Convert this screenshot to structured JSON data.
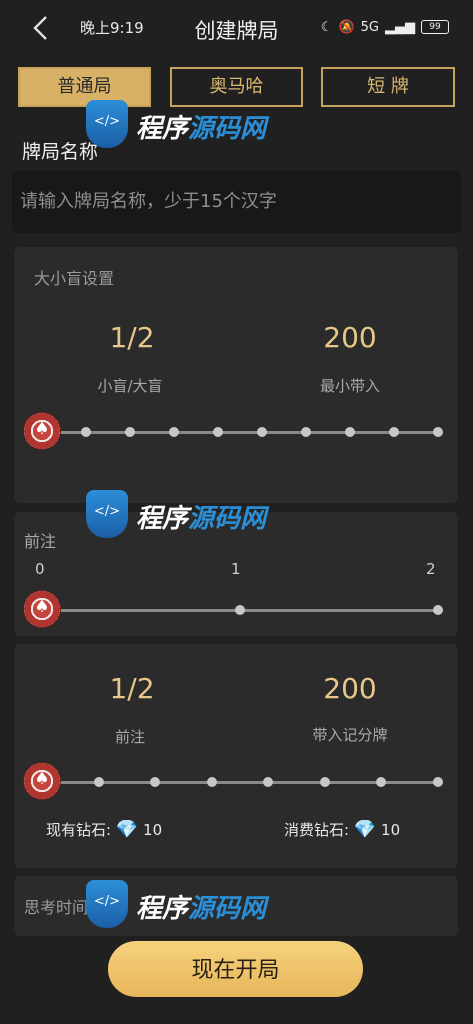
{
  "status": {
    "time": "晚上9:19",
    "battery": "99",
    "network": "5G"
  },
  "header": {
    "title": "创建牌局"
  },
  "tabs": [
    {
      "label": "普通局",
      "active": true
    },
    {
      "label": "奥马哈",
      "active": false
    },
    {
      "label": "短 牌",
      "active": false
    }
  ],
  "name_section": {
    "label": "牌局名称",
    "placeholder": "请输入牌局名称，少于15个汉字"
  },
  "blinds": {
    "title": "大小盲设置",
    "blind_value": "1/2",
    "blind_label": "小盲/大盲",
    "min_buyin_value": "200",
    "min_buyin_label": "最小带入",
    "slider_position": 0
  },
  "ante": {
    "title": "前注",
    "ticks": [
      "0",
      "1",
      "2"
    ],
    "slider_position": 0
  },
  "summary": {
    "ante_value": "1/2",
    "ante_label": "前注",
    "buyin_value": "200",
    "buyin_label": "带入记分牌",
    "slider_position": 0,
    "diamonds_owned_label": "现有钻石:",
    "diamonds_owned": "10",
    "diamonds_cost_label": "消费钻石:",
    "diamonds_cost": "10"
  },
  "thinking": {
    "title": "思考时间"
  },
  "start_button": {
    "label": "现在开局"
  },
  "watermark": {
    "text_white": "程序",
    "text_blue": "源码网"
  },
  "colors": {
    "accent": "#d8b166",
    "value": "#e8c889",
    "background": "#202020",
    "card": "#2b2b2b"
  }
}
